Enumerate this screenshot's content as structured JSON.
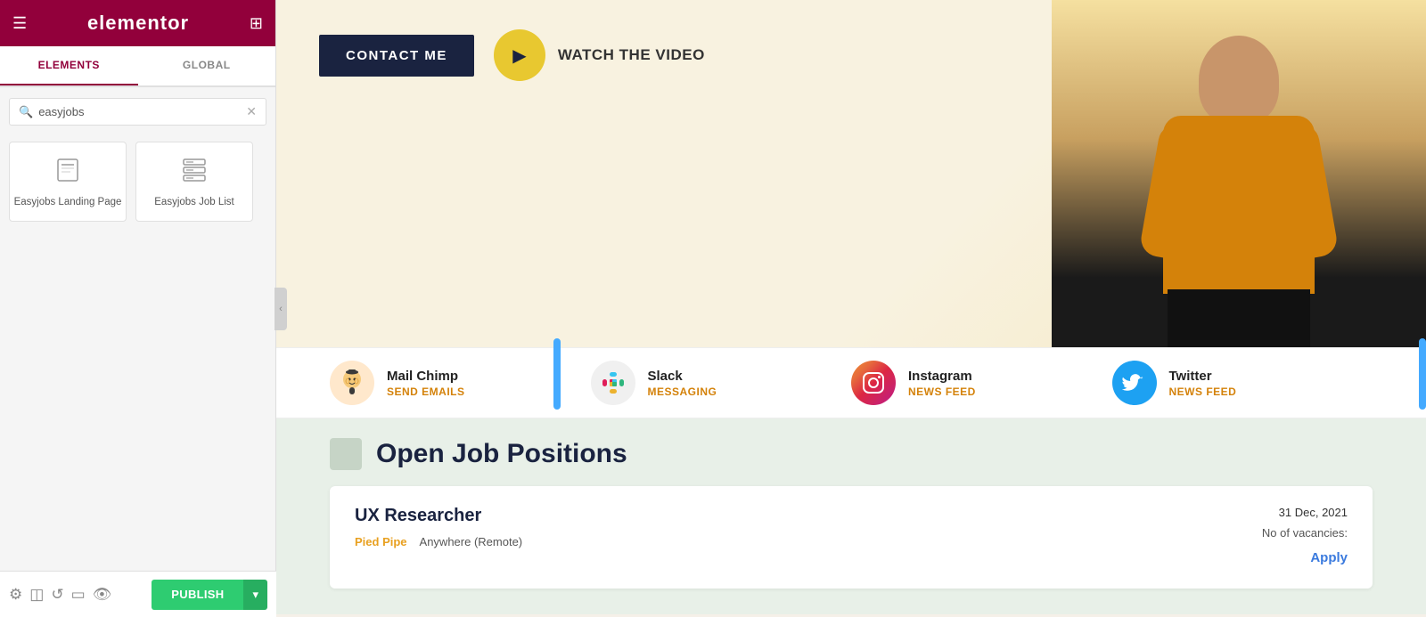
{
  "topbar": {
    "logo": "elementor",
    "menu_icon": "☰",
    "grid_icon": "⊞"
  },
  "tabs": {
    "elements_label": "ELEMENTS",
    "global_label": "GLOBAL",
    "active": "elements"
  },
  "search": {
    "placeholder": "easyjobs",
    "value": "easyjobs"
  },
  "elements": [
    {
      "label": "Easyjobs Landing Page",
      "icon": "📄"
    },
    {
      "label": "Easyjobs Job List",
      "icon": "📋"
    }
  ],
  "bottombar": {
    "settings_icon": "⚙",
    "layers_icon": "◫",
    "history_icon": "↺",
    "responsive_icon": "▭",
    "eye_icon": "👁",
    "publish_label": "PUBLISH",
    "publish_arrow": "▾"
  },
  "hero": {
    "contact_btn": "CONTACT ME",
    "video_label": "WATCH THE VIDEO"
  },
  "social": [
    {
      "name": "Mail Chimp",
      "action": "SEND EMAILS",
      "icon": "🐵",
      "icon_bg": "#ffe8cc"
    },
    {
      "name": "Slack",
      "action": "MESSAGING",
      "icon": "slack",
      "icon_bg": "#f8f8f8"
    },
    {
      "name": "Instagram",
      "action": "NEWS FEED",
      "icon": "ig",
      "icon_bg": "instagram"
    },
    {
      "name": "Twitter",
      "action": "NEWS FEED",
      "icon": "tw",
      "icon_bg": "#1da1f2"
    }
  ],
  "jobs_section": {
    "title": "Open Job Positions"
  },
  "job_card": {
    "title": "UX Researcher",
    "company": "Pied Pipe",
    "location": "Anywhere (Remote)",
    "date": "31 Dec, 2021",
    "vacancies_label": "No of vacancies:",
    "apply_label": "Apply"
  },
  "collapse_icon": "‹"
}
